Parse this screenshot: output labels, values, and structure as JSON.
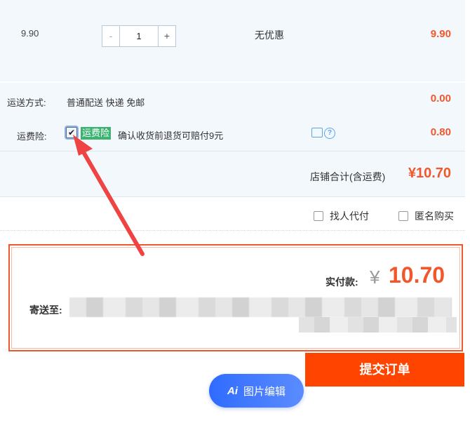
{
  "item": {
    "unit_price": "9.90",
    "quantity": "1",
    "minus_label": "-",
    "plus_label": "+",
    "discount": "无优惠",
    "total": "9.90"
  },
  "shipping": {
    "method_label": "运送方式:",
    "method_value": "普通配送 快递 免邮",
    "method_fee": "0.00",
    "insurance_label": "运费险:",
    "insurance_checked": "✔",
    "insurance_tag": "运费险",
    "insurance_desc": "确认收货前退货可赔付9元",
    "insurance_fee": "0.80",
    "store_total_label": "店铺合计(含运费)",
    "store_total_value": "¥10.70"
  },
  "options": {
    "proxy_pay": "找人代付",
    "anonymous": "匿名购买"
  },
  "summary": {
    "pay_label": "实付款:",
    "currency": "¥",
    "amount": "10.70",
    "address_label": "寄送至:"
  },
  "submit_label": "提交订单",
  "edit_pill": {
    "ai": "Ai",
    "label": "图片编辑"
  },
  "colors": {
    "accent": "#f2572b",
    "submit": "#ff4400",
    "tag_green": "#3cb371",
    "pill_blue": "#2f6bff"
  }
}
